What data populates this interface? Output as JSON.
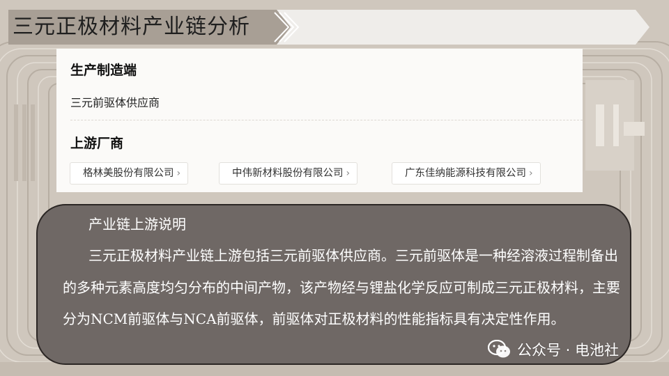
{
  "title": "三元正极材料产业链分析",
  "card": {
    "production_heading": "生产制造端",
    "production_item": "三元前驱体供应商",
    "upstream_heading": "上游厂商",
    "companies": [
      "格林美股份有限公司",
      "中伟新材料股份有限公司",
      "广东佳纳能源科技有限公司"
    ],
    "chevron": "›"
  },
  "description": {
    "heading": "产业链上游说明",
    "paragraph": "三元正极材料产业链上游包括三元前驱体供应商。三元前驱体是一种经溶液过程制备出的多种元素高度均匀分布的中间产物，该产物经与锂盐化学反应可制成三元正极材料，主要分为NCM前驱体与NCA前驱体，前驱体对正极材料的性能指标具有决定性作用。"
  },
  "watermark": {
    "icon": "wechat-icon",
    "text": "公众号 · 电池社"
  },
  "colors": {
    "background": "#cfc7bd",
    "banner_dark": "#a89f95",
    "banner_light": "#efedea",
    "card": "#fbfaf8",
    "desc_box": "#6f6865"
  }
}
